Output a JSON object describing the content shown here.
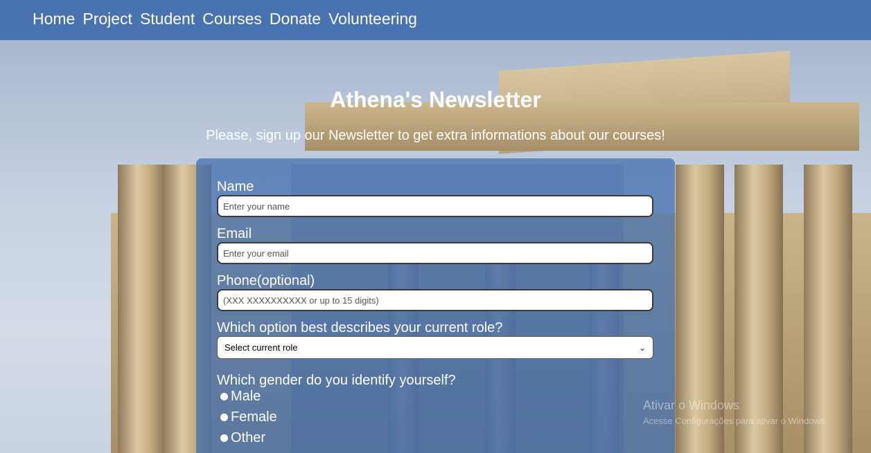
{
  "nav": {
    "items": [
      "Home",
      "Project",
      "Student",
      "Courses",
      "Donate",
      "Volunteering"
    ]
  },
  "header": {
    "title": "Athena's Newsletter",
    "subtitle": "Please, sign up our Newsletter to get extra informations about our courses!"
  },
  "form": {
    "name_label": "Name",
    "name_placeholder": "Enter your name",
    "email_label": "Email",
    "email_placeholder": "Enter your email",
    "phone_label": "Phone(optional)",
    "phone_placeholder": "(XXX XXXXXXXXXX or up to 15 digits)",
    "role_label": "Which option best describes your current role?",
    "role_selected": "Select current role",
    "gender_label": "Which gender do you identify yourself?",
    "gender_options": [
      "Male",
      "Female",
      "Other"
    ]
  },
  "watermark": {
    "line1": "Ativar o Windows",
    "line2": "Acesse Configurações para ativar o Windows."
  },
  "colors": {
    "nav_bg": "#4872b0",
    "card_bg": "rgba(72,114,176,0.78)",
    "text": "#ffffff"
  }
}
